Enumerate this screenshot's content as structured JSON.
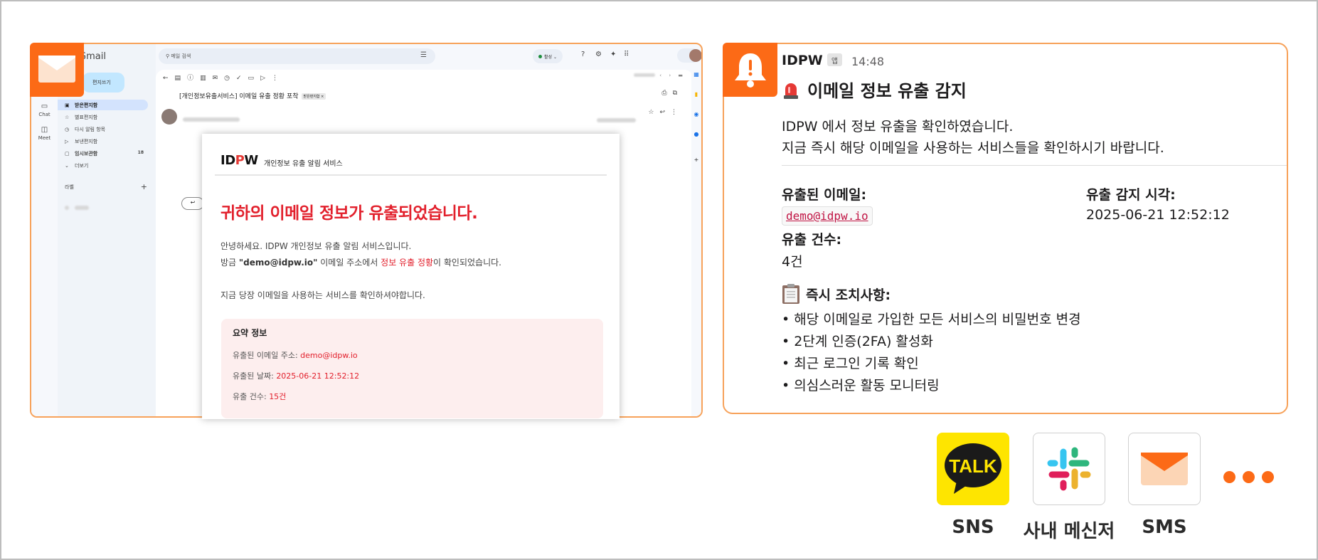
{
  "colors": {
    "accent": "#fc6a16",
    "border_accent": "#f7a25a",
    "alert_red": "#e2202c",
    "kakao_yellow": "#fee500"
  },
  "gmail": {
    "logo": "Gmail",
    "compose": "편지쓰기",
    "search_placeholder": "메일 검색",
    "status": "활성",
    "rail": {
      "chat": "Chat",
      "meet": "Meet"
    },
    "nav": [
      {
        "icon": "inbox-icon",
        "label": "받은편지함",
        "count": ""
      },
      {
        "icon": "star-icon",
        "label": "별표편지함",
        "count": ""
      },
      {
        "icon": "clock-icon",
        "label": "다시 알림 항목",
        "count": ""
      },
      {
        "icon": "send-icon",
        "label": "보낸편지함",
        "count": ""
      },
      {
        "icon": "draft-icon",
        "label": "임시보관함",
        "count": "18"
      },
      {
        "icon": "chevron-down-icon",
        "label": "더보기",
        "count": ""
      }
    ],
    "labels_heading": "라벨",
    "subject": "[개인정보유출서비스] 이메일 유출 정황 포착",
    "subject_tag": "받은편지함 ×",
    "email": {
      "brand": "IDPW",
      "brand_sub": "개인정보 유출 알림 서비스",
      "headline": "귀하의 이메일 정보가 유출되었습니다.",
      "p1": "안녕하세요. IDPW 개인정보 유출 알림 서비스입니다.",
      "p2_prefix": "방금 ",
      "p2_email": "\"demo@idpw.io\"",
      "p2_mid": " 이메일 주소에서 ",
      "p2_red": "정보 유출 정황",
      "p2_suffix": "이 확인되었습니다.",
      "p3": "지금 당장 이메일을 사용하는 서비스를 확인하셔야합니다.",
      "summary_title": "요약 정보",
      "summary": [
        {
          "label": "유출된 이메일 주소: ",
          "value": "demo@idpw.io"
        },
        {
          "label": "유출된 날짜: ",
          "value": "2025-06-21 12:52:12"
        },
        {
          "label": "유출 건수: ",
          "value": "15건"
        }
      ]
    }
  },
  "slack": {
    "app_name": "IDPW",
    "app_badge": "앱",
    "time": "14:48",
    "title": "이메일 정보 유출 감지",
    "line1": "IDPW 에서 정보 유출을 확인하였습니다.",
    "line2": "지금 즉시 해당 이메일을 사용하는 서비스들을 확인하시기 바랍니다.",
    "leaked_email_label": "유출된 이메일:",
    "leaked_email_value": "demo@idpw.io",
    "detect_time_label": "유출 감지 시각:",
    "detect_time_value": "2025-06-21 12:52:12",
    "count_label": "유출 건수:",
    "count_value": "4건",
    "actions_heading": "즉시 조치사항:",
    "actions": [
      "• 해당 이메일로 가입한 모든 서비스의 비밀번호 변경",
      "• 2단계 인증(2FA) 활성화",
      "• 최근 로그인 기록 확인",
      "• 의심스러운 활동 모니터링"
    ]
  },
  "channels": [
    {
      "name": "kakaotalk-icon",
      "label": "SNS",
      "tile_text": "TALK"
    },
    {
      "name": "slack-icon",
      "label": "사내 메신저"
    },
    {
      "name": "mail-icon",
      "label": "SMS"
    }
  ]
}
